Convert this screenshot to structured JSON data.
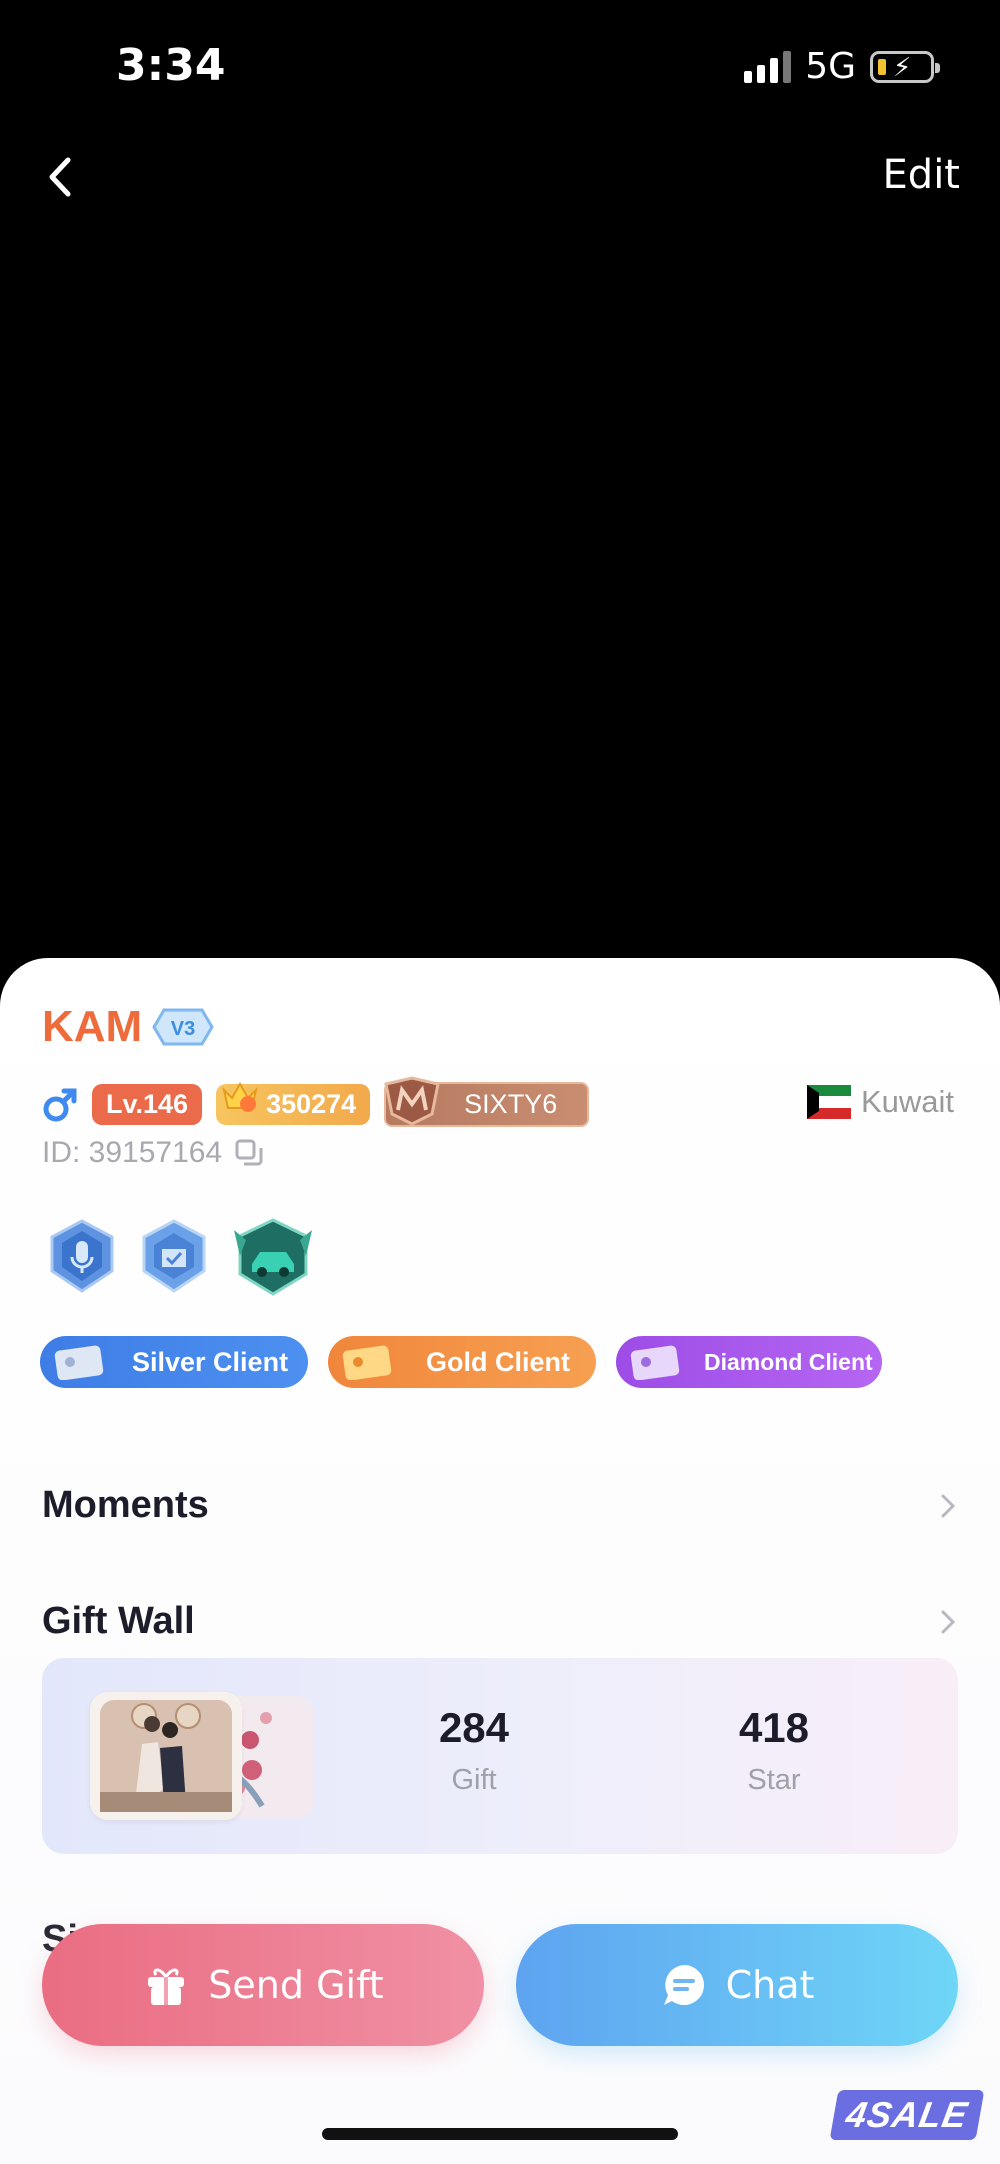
{
  "status": {
    "time": "3:34",
    "network": "5G"
  },
  "nav": {
    "edit_label": "Edit"
  },
  "profile": {
    "name": "KAM",
    "vip": "V3",
    "level": "Lv.146",
    "coins": "350274",
    "family": "SIXTY6",
    "country": "Kuwait",
    "id": "ID: 39157164"
  },
  "clients": [
    {
      "label": "Silver Client"
    },
    {
      "label": "Gold Client"
    },
    {
      "label": "Diamond Client"
    }
  ],
  "sections": {
    "moments": "Moments",
    "gift_wall": "Gift Wall",
    "partial": "Si"
  },
  "gift_wall": {
    "gift_count": "284",
    "gift_label": "Gift",
    "star_count": "418",
    "star_label": "Star"
  },
  "actions": {
    "send_gift": "Send Gift",
    "chat": "Chat"
  },
  "watermark": "4SALE",
  "colors": {
    "name": "#ee6b3b",
    "level_badge": "#ea6a4a",
    "silver": "#3e7de6",
    "gold": "#f0863b",
    "diamond": "#9d4de6",
    "send_gift": "#ea6d82",
    "chat": "#5ea3f0"
  },
  "icons": [
    "back-chevron-icon",
    "signal-icon",
    "battery-icon",
    "male-icon",
    "coin-crown-icon",
    "family-emblem-icon",
    "kuwait-flag-icon",
    "copy-icon",
    "mic-medal-icon",
    "shield-medal-icon",
    "car-medal-icon",
    "chevron-right-icon",
    "gift-icon",
    "chat-bubble-icon"
  ]
}
